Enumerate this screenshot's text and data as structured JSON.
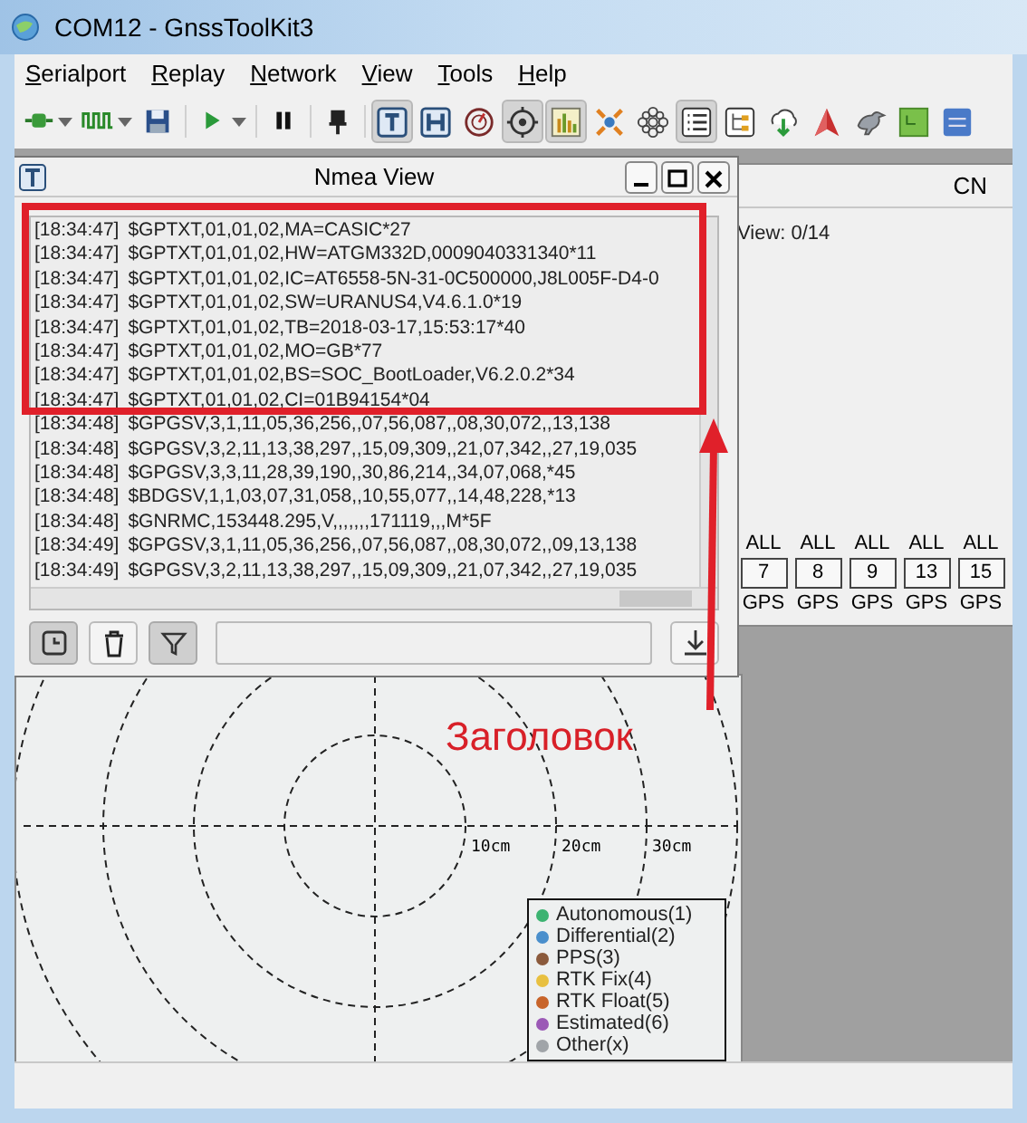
{
  "window": {
    "title": "COM12 - GnssToolKit3"
  },
  "menu": [
    {
      "label": "Serialport"
    },
    {
      "label": "Replay"
    },
    {
      "label": "Network"
    },
    {
      "label": "View"
    },
    {
      "label": "Tools"
    },
    {
      "label": "Help"
    }
  ],
  "toolbar": [
    {
      "kind": "button",
      "pressed": false,
      "dropdown": true
    },
    {
      "kind": "button",
      "pressed": false,
      "dropdown": true
    },
    {
      "kind": "button",
      "pressed": false,
      "dropdown": false
    },
    {
      "kind": "separator"
    },
    {
      "kind": "button",
      "pressed": false,
      "dropdown": true
    },
    {
      "kind": "separator"
    },
    {
      "kind": "button",
      "pressed": false,
      "dropdown": false
    },
    {
      "kind": "separator"
    },
    {
      "kind": "button",
      "pressed": false,
      "dropdown": false
    },
    {
      "kind": "separator"
    },
    {
      "kind": "button",
      "pressed": true,
      "dropdown": false
    },
    {
      "kind": "button",
      "pressed": false,
      "dropdown": false
    },
    {
      "kind": "button",
      "pressed": false,
      "dropdown": false
    },
    {
      "kind": "button",
      "pressed": true,
      "dropdown": false
    },
    {
      "kind": "button",
      "pressed": true,
      "dropdown": false
    },
    {
      "kind": "button",
      "pressed": false,
      "dropdown": false
    },
    {
      "kind": "button",
      "pressed": false,
      "dropdown": false
    },
    {
      "kind": "button",
      "pressed": true,
      "dropdown": false
    },
    {
      "kind": "button",
      "pressed": false,
      "dropdown": false
    },
    {
      "kind": "button",
      "pressed": false,
      "dropdown": false
    },
    {
      "kind": "button",
      "pressed": false,
      "dropdown": false
    },
    {
      "kind": "button",
      "pressed": false,
      "dropdown": false
    },
    {
      "kind": "button",
      "pressed": false,
      "dropdown": false
    },
    {
      "kind": "button",
      "pressed": false,
      "dropdown": false
    }
  ],
  "nmea_view": {
    "title": "Nmea View",
    "lines": [
      {
        "time": "[18:34:47]",
        "sentence": "$GPTXT,01,01,02,MA=CASIC*27"
      },
      {
        "time": "[18:34:47]",
        "sentence": "$GPTXT,01,01,02,HW=ATGM332D,0009040331340*11"
      },
      {
        "time": "[18:34:47]",
        "sentence": "$GPTXT,01,01,02,IC=AT6558-5N-31-0C500000,J8L005F-D4-0"
      },
      {
        "time": "[18:34:47]",
        "sentence": "$GPTXT,01,01,02,SW=URANUS4,V4.6.1.0*19"
      },
      {
        "time": "[18:34:47]",
        "sentence": "$GPTXT,01,01,02,TB=2018-03-17,15:53:17*40"
      },
      {
        "time": "[18:34:47]",
        "sentence": "$GPTXT,01,01,02,MO=GB*77"
      },
      {
        "time": "[18:34:47]",
        "sentence": "$GPTXT,01,01,02,BS=SOC_BootLoader,V6.2.0.2*34"
      },
      {
        "time": "[18:34:47]",
        "sentence": "$GPTXT,01,01,02,CI=01B94154*04"
      },
      {
        "time": "[18:34:48]",
        "sentence": "$GPGSV,3,1,11,05,36,256,,07,56,087,,08,30,072,,13,138"
      },
      {
        "time": "[18:34:48]",
        "sentence": "$GPGSV,3,2,11,13,38,297,,15,09,309,,21,07,342,,27,19,035"
      },
      {
        "time": "[18:34:48]",
        "sentence": "$GPGSV,3,3,11,28,39,190,,30,86,214,,34,07,068,*45"
      },
      {
        "time": "[18:34:48]",
        "sentence": "$BDGSV,1,1,03,07,31,058,,10,55,077,,14,48,228,*13"
      },
      {
        "time": "[18:34:48]",
        "sentence": "$GNRMC,153448.295,V,,,,,,,171119,,,M*5F"
      },
      {
        "time": "[18:34:49]",
        "sentence": "$GPGSV,3,1,11,05,36,256,,07,56,087,,08,30,072,,09,13,138"
      },
      {
        "time": "[18:34:49]",
        "sentence": "$GPGSV,3,2,11,13,38,297,,15,09,309,,21,07,342,,27,19,035"
      }
    ],
    "tools": [
      {
        "kind": "timestamp",
        "pressed": true
      },
      {
        "kind": "clear",
        "pressed": false
      },
      {
        "kind": "filter",
        "pressed": true
      }
    ]
  },
  "cn_panel": {
    "title": "CN",
    "in_view": "View: 0/14",
    "satellites": [
      {
        "filter": "ALL",
        "prn": "7",
        "system": "GPS"
      },
      {
        "filter": "ALL",
        "prn": "8",
        "system": "GPS"
      },
      {
        "filter": "ALL",
        "prn": "9",
        "system": "GPS"
      },
      {
        "filter": "ALL",
        "prn": "13",
        "system": "GPS"
      },
      {
        "filter": "ALL",
        "prn": "15",
        "system": "GPS"
      }
    ]
  },
  "plot": {
    "ring_labels": [
      "10cm",
      "20cm",
      "30cm"
    ],
    "legend": [
      {
        "label": "Autonomous(1)",
        "color": "#3cb371"
      },
      {
        "label": "Differential(2)",
        "color": "#4a8fcc"
      },
      {
        "label": "PPS(3)",
        "color": "#8b5a3c"
      },
      {
        "label": "RTK Fix(4)",
        "color": "#e8c040"
      },
      {
        "label": "RTK Float(5)",
        "color": "#c8642a"
      },
      {
        "label": "Estimated(6)",
        "color": "#9b59b6"
      },
      {
        "label": "Other(x)",
        "color": "#a0a4a8"
      }
    ]
  },
  "annotation": {
    "label": "Заголовок"
  }
}
